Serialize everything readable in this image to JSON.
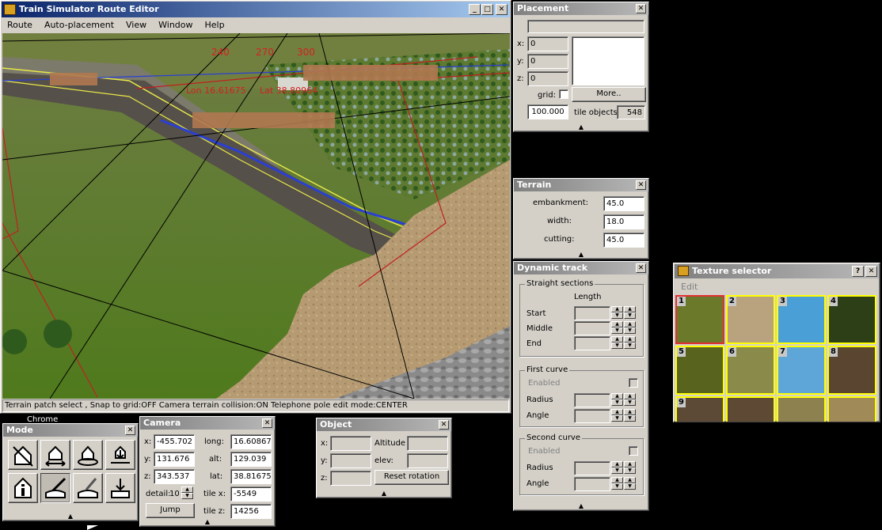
{
  "main_window": {
    "title": "Train Simulator Route Editor",
    "menu": [
      "Route",
      "Auto-placement",
      "View",
      "Window",
      "Help"
    ],
    "status_text": "Terrain patch select , Snap to grid:OFF Camera terrain collision:ON Telephone pole edit mode:CENTER",
    "overlay_numbers": [
      "240",
      "270",
      "300"
    ],
    "overlay_coord_1": "Lon 16.61675",
    "overlay_coord_2": "Lat 38.80964"
  },
  "taskbar_peek": "Chrome",
  "placement": {
    "title": "Placement",
    "x_label": "x:",
    "x_value": "0",
    "y_label": "y:",
    "y_value": "0",
    "z_label": "z:",
    "z_value": "0",
    "grid_label": "grid:",
    "more_button": "More..",
    "grid_value": "100.000",
    "tile_objects_label": "tile objects:",
    "tile_objects_value": "548"
  },
  "terrain": {
    "title": "Terrain",
    "embankment_label": "embankment:",
    "embankment_value": "45.0",
    "width_label": "width:",
    "width_value": "18.0",
    "cutting_label": "cutting:",
    "cutting_value": "45.0"
  },
  "dynamic_track": {
    "title": "Dynamic track",
    "straight_group": "Straight sections",
    "length_header": "Length",
    "start_label": "Start",
    "middle_label": "Middle",
    "end_label": "End",
    "first_curve_group": "First curve",
    "second_curve_group": "Second curve",
    "enabled_label": "Enabled",
    "radius_label": "Radius",
    "angle_label": "Angle"
  },
  "texture_selector": {
    "title": "Texture selector",
    "menu_edit": "Edit",
    "help_button": "?",
    "tiles": [
      {
        "num": "1",
        "color": "#6b7a2a"
      },
      {
        "num": "2",
        "color": "#b9a27e"
      },
      {
        "num": "3",
        "color": "#4a9fd6"
      },
      {
        "num": "4",
        "color": "#2c3f16"
      },
      {
        "num": "5",
        "color": "#58641e"
      },
      {
        "num": "6",
        "color": "#8a8a4a"
      },
      {
        "num": "7",
        "color": "#5ea6d8"
      },
      {
        "num": "8",
        "color": "#5a4630"
      },
      {
        "num": "9",
        "color": "#5c4a36"
      },
      {
        "num": "",
        "color": "#5e4a34"
      },
      {
        "num": "",
        "color": "#8d8150"
      },
      {
        "num": "",
        "color": "#a08a58"
      }
    ]
  },
  "mode": {
    "title": "Mode",
    "icons": [
      "delete-object-icon",
      "move-object-icon",
      "rotate-object-icon",
      "raise-lower-object-icon",
      "info-icon",
      "terrain-brush-icon",
      "terrain-pencil-icon",
      "terrain-lower-icon"
    ]
  },
  "camera": {
    "title": "Camera",
    "x_label": "x:",
    "x_value": "-455.702",
    "y_label": "y:",
    "y_value": "131.676",
    "z_label": "z:",
    "z_value": "343.537",
    "long_label": "long:",
    "long_value": "16.60867",
    "alt_label": "alt:",
    "alt_value": "129.039",
    "lat_label": "lat:",
    "lat_value": "38.81675",
    "detail_label": "detail:",
    "detail_value": "10",
    "tile_x_label": "tile x:",
    "tile_x_value": "-5549",
    "tile_z_label": "tile z:",
    "tile_z_value": "14256",
    "jump_button": "Jump"
  },
  "object": {
    "title": "Object",
    "x_label": "x:",
    "y_label": "y:",
    "z_label": "z:",
    "altitude_label": "Altitude",
    "elev_label": "elev:",
    "reset_button": "Reset rotation"
  },
  "colors": {
    "titlebar_active": "#0a246a",
    "panel_bg": "#d4d0c8",
    "overlay_red": "#d42020",
    "tile_border": "#ffff00",
    "selected_tile_border": "#e03030"
  }
}
